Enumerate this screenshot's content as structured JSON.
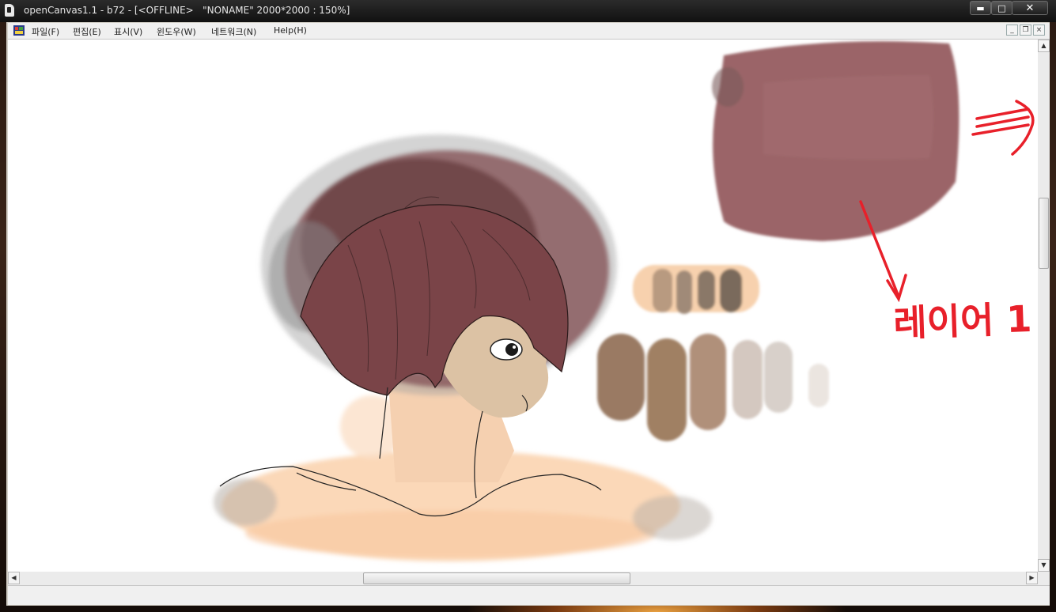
{
  "window": {
    "title": "openCanvas1.1 - b72 - [<OFFLINE>   \"NONAME\" 2000*2000 : 150%]",
    "minimize_glyph": "▬",
    "maximize_glyph": "□",
    "close_glyph": "✕"
  },
  "menubar": {
    "items": [
      {
        "label": "파일(F)"
      },
      {
        "label": "편집(E)"
      },
      {
        "label": "표시(V)"
      },
      {
        "label": "윈도우(W)"
      },
      {
        "label": "네트워크(N)"
      },
      {
        "label": "Help(H)"
      }
    ],
    "mdi_minimize_glyph": "_",
    "mdi_restore_glyph": "❐",
    "mdi_close_glyph": "×"
  },
  "scrollbars": {
    "up_glyph": "▲",
    "down_glyph": "▼",
    "left_glyph": "◀",
    "right_glyph": "▶"
  },
  "canvas": {
    "annotation_text": "레이어 1",
    "colors": {
      "hair": "#7a4a4c",
      "hair_dark": "#4e2e30",
      "swatch": "#986062",
      "skin": "#fcd9b8",
      "skin_shadow": "#d8b89a",
      "red_ink": "#e8202a",
      "grey_wash": "#9a9a9a"
    }
  }
}
